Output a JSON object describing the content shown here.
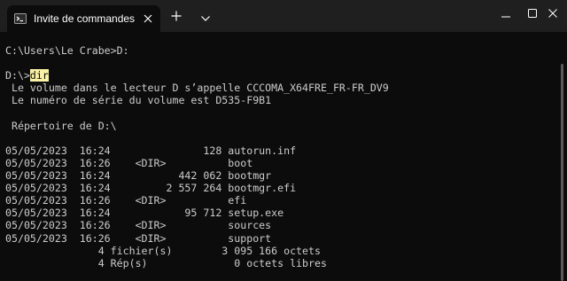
{
  "tab": {
    "title": "Invite de commandes"
  },
  "icons": {
    "tab_icon": "terminal-icon",
    "tab_close": "close-icon",
    "new_tab": "plus-icon",
    "dropdown": "chevron-down-icon",
    "minimize": "minimize-icon",
    "maximize": "maximize-icon",
    "close": "close-icon"
  },
  "colors": {
    "background": "#0c0c0c",
    "titlebar": "#1f1f1f",
    "text": "#cccccc",
    "highlight": "#f9f1a5"
  },
  "terminal": {
    "lines": [
      "",
      "C:\\Users\\Le Crabe>D:",
      "",
      "D:\\>",
      " Le volume dans le lecteur D s’appelle CCCOMA_X64FRE_FR-FR_DV9",
      " Le numéro de série du volume est D535-F9B1",
      "",
      " Répertoire de D:\\",
      "",
      "05/05/2023  16:24               128 autorun.inf",
      "05/05/2023  16:26    <DIR>          boot",
      "05/05/2023  16:24           442 062 bootmgr",
      "05/05/2023  16:24         2 557 264 bootmgr.efi",
      "05/05/2023  16:26    <DIR>          efi",
      "05/05/2023  16:24            95 712 setup.exe",
      "05/05/2023  16:26    <DIR>          sources",
      "05/05/2023  16:26    <DIR>          support",
      "               4 fichier(s)        3 095 166 octets",
      "               4 Rép(s)              0 octets libres"
    ],
    "command": "dir"
  }
}
